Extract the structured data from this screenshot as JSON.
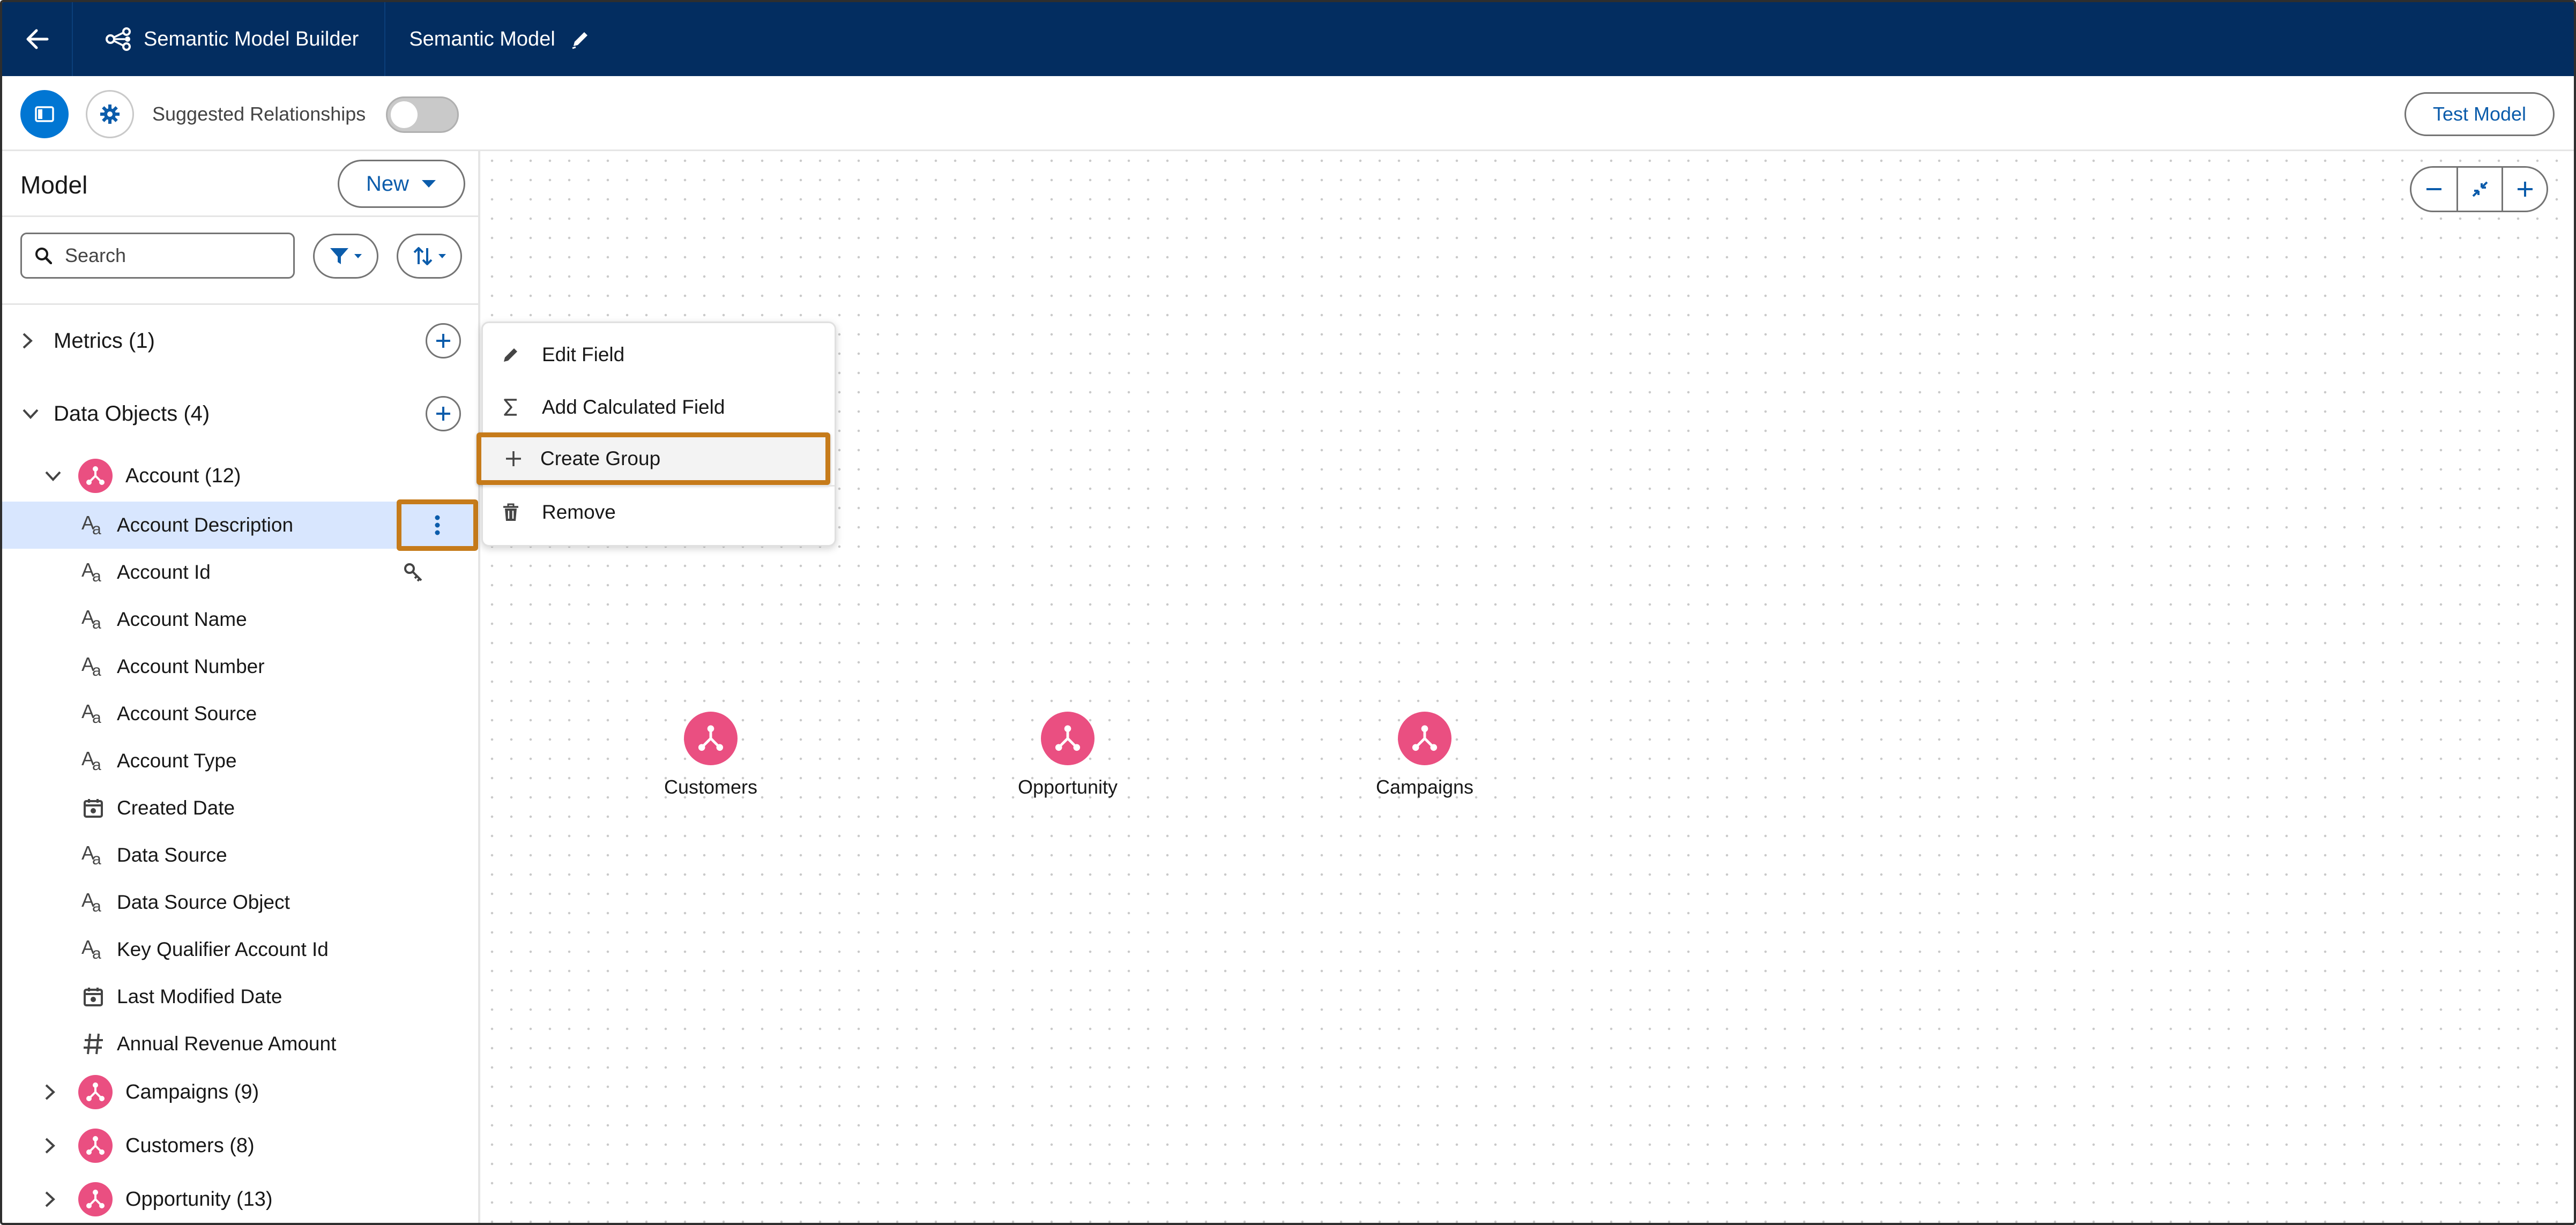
{
  "header": {
    "app_name": "Semantic Model Builder",
    "model_name": "Semantic Model"
  },
  "toolbar": {
    "suggested_relationships_label": "Suggested Relationships",
    "suggested_relationships_on": false,
    "test_model_label": "Test Model"
  },
  "sidebar": {
    "title": "Model",
    "new_label": "New",
    "search_placeholder": "Search",
    "metrics_label": "Metrics (1)",
    "data_objects_label": "Data Objects (4)",
    "account": {
      "label": "Account (12)",
      "fields": [
        {
          "label": "Account Description",
          "type": "text",
          "selected": true
        },
        {
          "label": "Account Id",
          "type": "text",
          "key": true
        },
        {
          "label": "Account Name",
          "type": "text"
        },
        {
          "label": "Account Number",
          "type": "text"
        },
        {
          "label": "Account Source",
          "type": "text"
        },
        {
          "label": "Account Type",
          "type": "text"
        },
        {
          "label": "Created Date",
          "type": "date"
        },
        {
          "label": "Data Source",
          "type": "text"
        },
        {
          "label": "Data Source Object",
          "type": "text"
        },
        {
          "label": "Key Qualifier Account Id",
          "type": "text"
        },
        {
          "label": "Last Modified Date",
          "type": "date"
        },
        {
          "label": "Annual Revenue Amount",
          "type": "number"
        }
      ]
    },
    "other_objects": [
      {
        "label": "Campaigns (9)"
      },
      {
        "label": "Customers (8)"
      },
      {
        "label": "Opportunity (13)"
      }
    ]
  },
  "context_menu": {
    "items": [
      {
        "label": "Edit Field",
        "icon": "pencil-icon"
      },
      {
        "label": "Add Calculated Field",
        "icon": "sigma-icon"
      },
      {
        "label": "Create Group",
        "icon": "plus-icon",
        "highlighted": true
      },
      {
        "label": "Remove",
        "icon": "trash-icon"
      }
    ]
  },
  "canvas": {
    "nodes": [
      {
        "label": "Customers"
      },
      {
        "label": "Opportunity"
      },
      {
        "label": "Campaigns"
      }
    ]
  },
  "colors": {
    "header_bg": "#032d60",
    "brand_blue": "#0176d3",
    "object_pink": "#ea4f81",
    "highlight_orange": "#c67b1a",
    "selected_row": "#d8e6fe"
  }
}
